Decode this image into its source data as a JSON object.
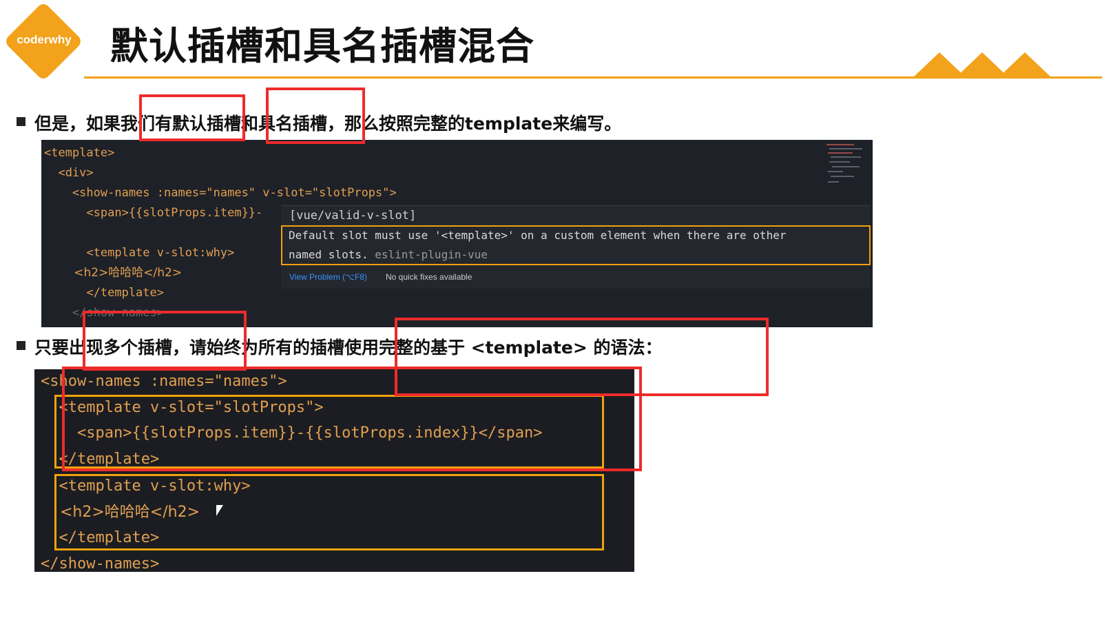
{
  "header": {
    "logo_text": "coderwhy",
    "title": "默认插槽和具名插槽混合"
  },
  "bullets": [
    {
      "text": "但是，如果我们有默认插槽和具名插槽，那么按照完整的template来编写。"
    },
    {
      "text": "只要出现多个插槽，请始终为所有的插槽使用完整的基于 <template> 的语法："
    }
  ],
  "editor": {
    "lines": [
      "<template>",
      "  <div>",
      "    <show-names :names=\"names\" v-slot=\"slotProps\">",
      "      <span>{{slotProps.item}}-",
      "",
      "      <template v-slot:why>",
      "        <h2>哈哈哈</h2>",
      "      </template>",
      "    </show-names>"
    ],
    "tooltip": {
      "rule": "[vue/valid-v-slot]",
      "message_line1": "Default slot must use '<template>' on a custom element when there are other",
      "message_line2": "named slots.",
      "source": "eslint-plugin-vue",
      "view_problem": "View Problem (⌥F8)",
      "no_fixes": "No quick fixes available"
    }
  },
  "example": {
    "lines": [
      "<show-names :names=\"names\">",
      "  <template v-slot=\"slotProps\">",
      "    <span>{{slotProps.item}}-{{slotProps.index}}</span>",
      "  </template>",
      "  <template v-slot:why>",
      "    <h2>哈哈哈</h2>",
      "  </template>",
      "</show-names>"
    ]
  },
  "colors": {
    "accent": "#f2a21b",
    "highlight_red": "#ee2b2b",
    "highlight_orange": "#f0a20c",
    "code_bg": "#1f2128"
  }
}
